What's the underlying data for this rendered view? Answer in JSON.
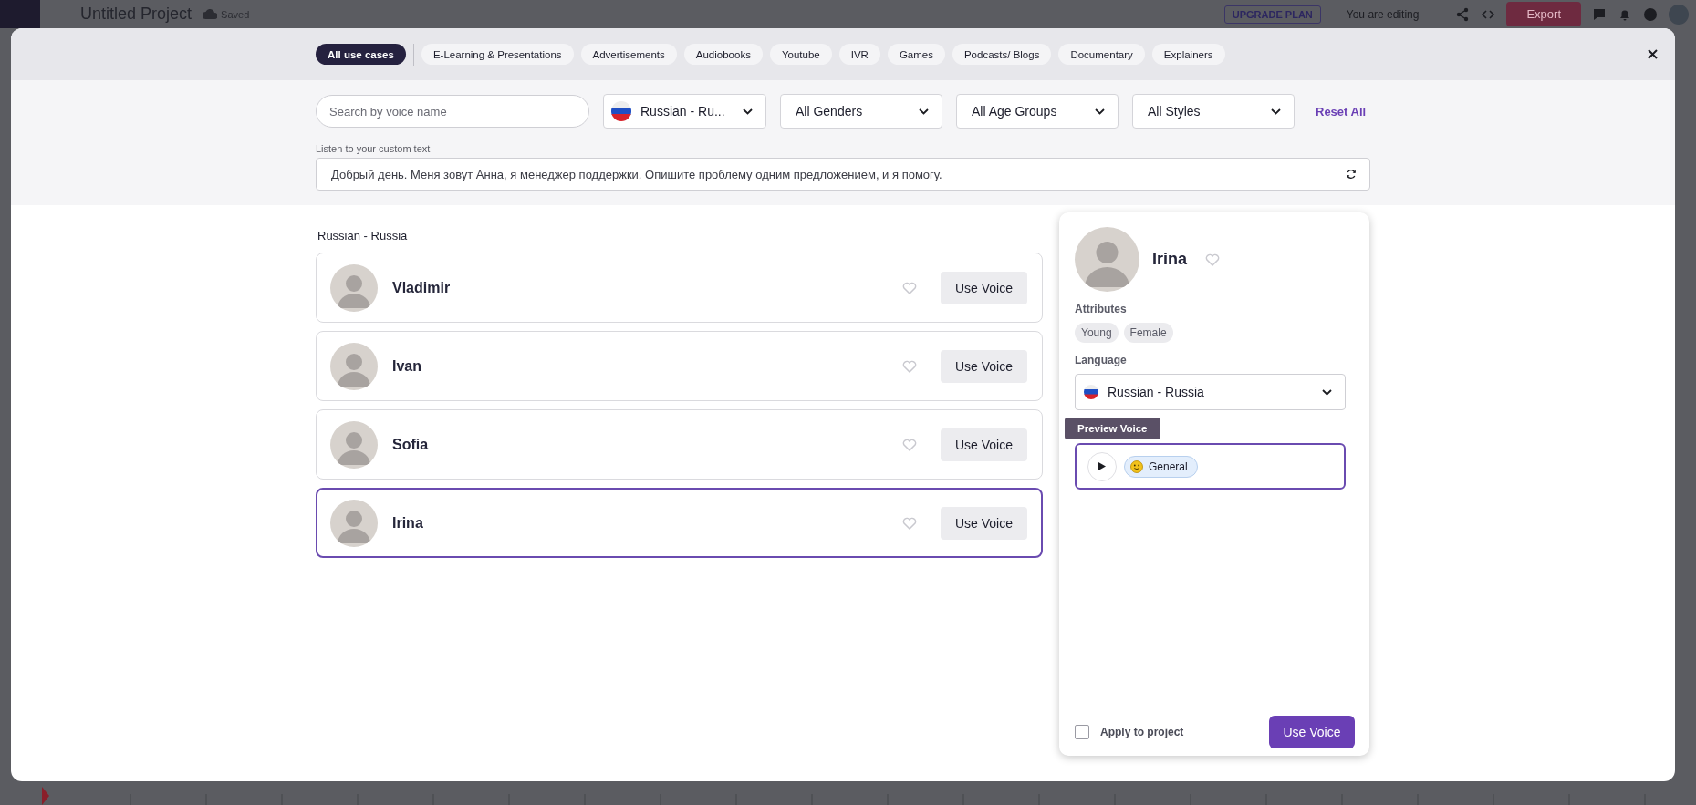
{
  "app_bar": {
    "project_title": "Untitled Project",
    "save_status": "Saved",
    "upgrade_button": "UPGRADE PLAN",
    "editing_label": "You are editing",
    "export_button": "Export"
  },
  "tabs": [
    {
      "label": "All use cases",
      "selected": true
    },
    {
      "label": "E-Learning & Presentations",
      "selected": false
    },
    {
      "label": "Advertisements",
      "selected": false
    },
    {
      "label": "Audiobooks",
      "selected": false
    },
    {
      "label": "Youtube",
      "selected": false
    },
    {
      "label": "IVR",
      "selected": false
    },
    {
      "label": "Games",
      "selected": false
    },
    {
      "label": "Podcasts/ Blogs",
      "selected": false
    },
    {
      "label": "Documentary",
      "selected": false
    },
    {
      "label": "Explainers",
      "selected": false
    }
  ],
  "filters": {
    "search": {
      "placeholder": "Search by voice name"
    },
    "selects": [
      {
        "value": "Russian - Ru...",
        "kind": "flag"
      },
      {
        "value": "All Genders",
        "kind": "plain"
      },
      {
        "value": "All Age Groups",
        "kind": "plain"
      },
      {
        "value": "All Styles",
        "kind": "plain"
      }
    ],
    "reset": "Reset All"
  },
  "custom_text": {
    "label": "Listen to your custom text",
    "value": "Добрый день. Меня зовут Анна, я менеджер поддержки. Опишите проблему одним предложением, и я помогу."
  },
  "group_title": "Russian - Russia",
  "voices": [
    {
      "name": "Vladimir",
      "favorite": false,
      "selected": false,
      "button": "Use Voice"
    },
    {
      "name": "Ivan",
      "favorite": false,
      "selected": false,
      "button": "Use Voice"
    },
    {
      "name": "Sofia",
      "favorite": false,
      "selected": false,
      "button": "Use Voice"
    },
    {
      "name": "Irina",
      "favorite": false,
      "selected": true,
      "button": "Use Voice"
    }
  ],
  "detail": {
    "name": "Irina",
    "favorite": false,
    "attributes_label": "Attributes",
    "attributes": [
      "Young",
      "Female"
    ],
    "language_label": "Language",
    "language": "Russian - Russia",
    "tooltip": "Preview Voice",
    "styles": [
      {
        "label": "General",
        "selected": true
      }
    ],
    "apply": {
      "label": "Apply to project",
      "checked": false
    },
    "button": "Use Voice"
  }
}
